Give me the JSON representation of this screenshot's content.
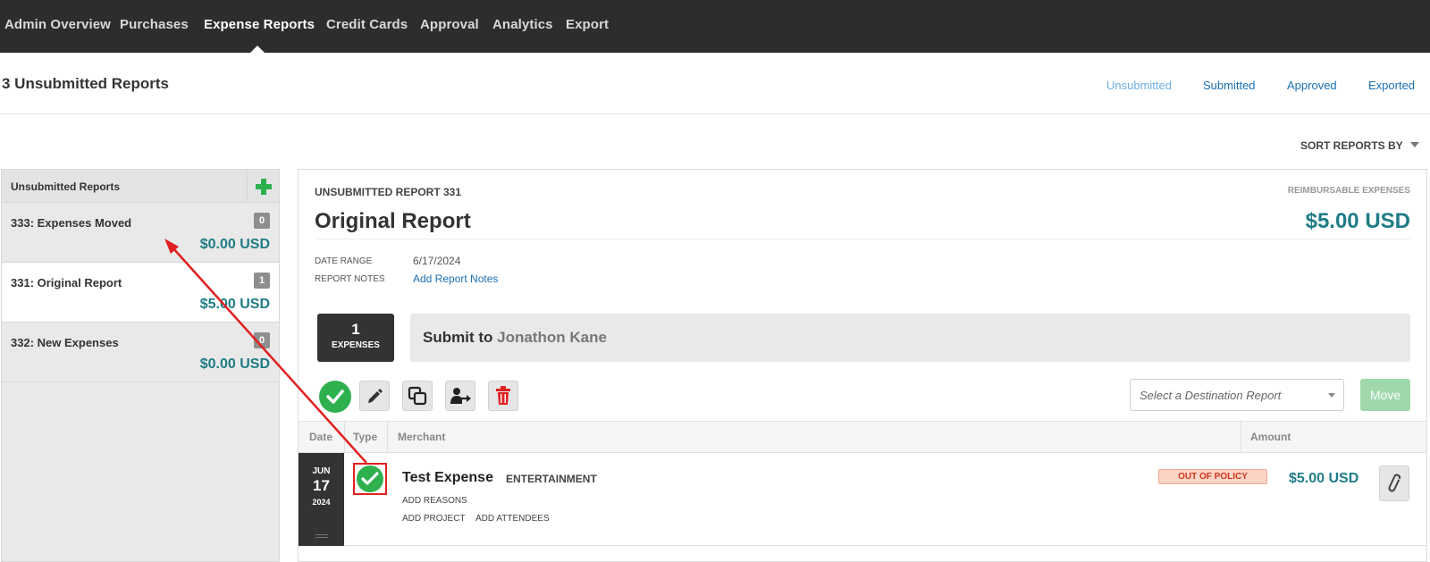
{
  "nav": {
    "items": [
      "Admin Overview",
      "Purchases",
      "Expense Reports",
      "Credit Cards",
      "Approval",
      "Analytics",
      "Export"
    ],
    "active": "Expense Reports"
  },
  "header": {
    "title": "3 Unsubmitted Reports",
    "status_tabs": [
      "Unsubmitted",
      "Submitted",
      "Approved",
      "Exported"
    ],
    "sort_label": "SORT REPORTS BY"
  },
  "sidebar": {
    "heading": "Unsubmitted Reports",
    "reports": [
      {
        "name": "333: Expenses Moved",
        "count": "0",
        "amount": "$0.00 USD",
        "selected": false
      },
      {
        "name": "331: Original Report",
        "count": "1",
        "amount": "$5.00 USD",
        "selected": true
      },
      {
        "name": "332: New Expenses",
        "count": "0",
        "amount": "$0.00 USD",
        "selected": false
      }
    ]
  },
  "report": {
    "number_label": "UNSUBMITTED REPORT 331",
    "reimbursable_label": "REIMBURSABLE EXPENSES",
    "title": "Original Report",
    "total": "$5.00 USD",
    "date_range_label": "DATE RANGE",
    "date_range": "6/17/2024",
    "notes_label": "REPORT NOTES",
    "notes_link": "Add Report Notes",
    "expense_count": "1",
    "expense_count_label": "EXPENSES",
    "submit_prefix": "Submit to",
    "submit_to": "Jonathon Kane",
    "destination_placeholder": "Select a Destination Report",
    "move_label": "Move"
  },
  "table": {
    "columns": [
      "Date",
      "Type",
      "Merchant",
      "Amount"
    ],
    "rows": [
      {
        "month": "JUN",
        "day": "17",
        "year": "2024",
        "merchant": "Test Expense",
        "category": "ENTERTAINMENT",
        "links": [
          "ADD REASONS",
          "ADD PROJECT",
          "ADD ATTENDEES"
        ],
        "policy_badge": "OUT OF POLICY",
        "amount": "$5.00 USD"
      }
    ]
  },
  "colors": {
    "nav_bg": "#2d2d2d",
    "accent_teal": "#1f7c86",
    "link_blue": "#1a6fb3",
    "success_green": "#2eb04f",
    "delete_red": "#e02020",
    "annotation_red": "#e02020"
  },
  "icons": [
    "plus-icon",
    "check-icon",
    "pencil-icon",
    "duplicate-icon",
    "reassign-icon",
    "trash-icon",
    "paperclip-icon",
    "chevron-down-icon"
  ]
}
